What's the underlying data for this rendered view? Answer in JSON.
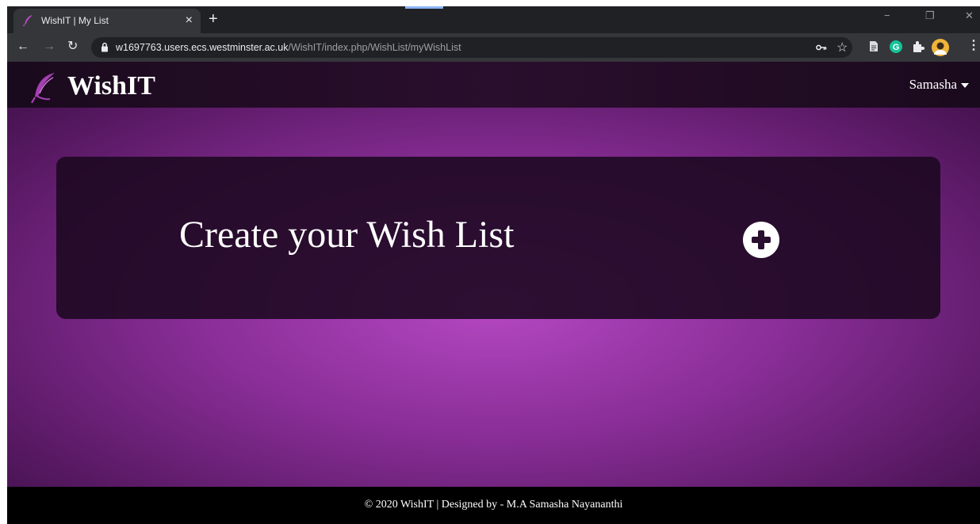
{
  "browser": {
    "tab": {
      "title": "WishIT | My List",
      "close_glyph": "×"
    },
    "new_tab_glyph": "+",
    "window_controls": {
      "minimize": "−",
      "restore": "❐",
      "close": "✕"
    },
    "nav": {
      "back": "←",
      "forward": "→",
      "reload": "↻"
    },
    "url": {
      "host": "w1697763.users.ecs.westminster.ac.uk",
      "path": "/WishIT/index.php/WishList/myWishList"
    },
    "toolbar_icons": [
      "key-icon",
      "star-icon",
      "reader-icon",
      "grammarly-extension-icon",
      "extensions-puzzle-icon",
      "profile-avatar",
      "menu-dots-icon"
    ],
    "star_glyph": "☆",
    "menu_glyph": "⋮"
  },
  "site": {
    "brand": "WishIT",
    "user_name": "Samasha",
    "heading": "Create your Wish List",
    "footer": "© 2020 WishIT | Designed by - M.A Samasha Nayananthi"
  },
  "colors": {
    "accent_purple": "#b548c2",
    "nav_dark": "#1a0a1d",
    "card_dark": "#2a1030",
    "footer": "#000000"
  }
}
